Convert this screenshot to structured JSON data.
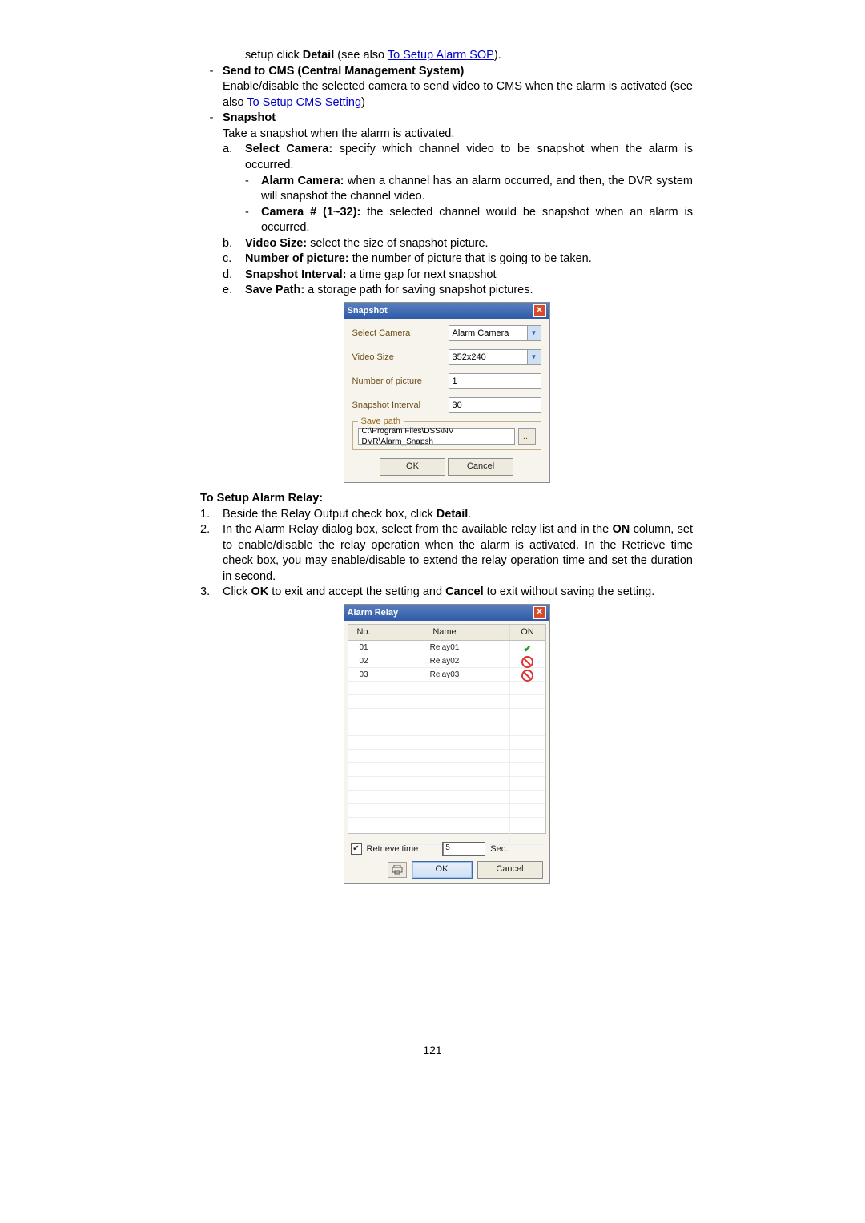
{
  "intro": {
    "line1_a": "setup click ",
    "line1_b": "Detail",
    "line1_c": " (see also ",
    "link_sop": "To Setup Alarm SOP",
    "line1_d": ")."
  },
  "cms": {
    "heading": "Send to CMS (Central Management System)",
    "body_a": "Enable/disable the selected camera to send video to CMS when the alarm is activated (see also ",
    "link": "To Setup CMS Setting",
    "body_b": ")"
  },
  "snapshot": {
    "heading": "Snapshot",
    "body": "Take a snapshot when the alarm is activated.",
    "a_label": "a.",
    "a_bold": "Select Camera:",
    "a_text": " specify which channel video to be snapshot when the alarm is occurred.",
    "dash1_bold": "Alarm Camera:",
    "dash1_text": " when a channel has an alarm occurred, and then, the DVR system will snapshot the channel video.",
    "dash2_bold": "Camera # (1~32):",
    "dash2_text": " the selected channel would be snapshot when an alarm is occurred.",
    "b_label": "b.",
    "b_bold": "Video Size:",
    "b_text": " select the size of snapshot picture.",
    "c_label": "c.",
    "c_bold": "Number of picture:",
    "c_text": " the number of picture that is going to be taken.",
    "d_label": "d.",
    "d_bold": "Snapshot Interval:",
    "d_text": " a time gap for next snapshot",
    "e_label": "e.",
    "e_bold": "Save Path:",
    "e_text": " a storage path for saving snapshot pictures."
  },
  "snapshot_dialog": {
    "title": "Snapshot",
    "labels": {
      "select_camera": "Select Camera",
      "video_size": "Video Size",
      "num_picture": "Number of picture",
      "interval": "Snapshot Interval"
    },
    "values": {
      "select_camera": "Alarm Camera",
      "video_size": "352x240",
      "num_picture": "1",
      "interval": "30"
    },
    "save_legend": "Save path",
    "save_value": "C:\\Program Files\\DSS\\NV DVR\\Alarm_Snapsh",
    "browse": "...",
    "ok": "OK",
    "cancel": "Cancel"
  },
  "relay_section": {
    "heading": "To Setup Alarm Relay:",
    "n1": "1.",
    "t1_a": "Beside the Relay Output check box, click ",
    "t1_b": "Detail",
    "t1_c": ".",
    "n2": "2.",
    "t2_a": "In the Alarm Relay dialog box, select from the available relay list and in the ",
    "t2_b": "ON",
    "t2_c": " column, set to enable/disable the relay operation when the alarm is activated. In the Retrieve time check box, you may enable/disable to extend the relay operation time and set the duration in second.",
    "n3": "3.",
    "t3_a": "Click ",
    "t3_b": "OK",
    "t3_c": " to exit and accept the setting and ",
    "t3_d": "Cancel",
    "t3_e": " to exit without saving the setting."
  },
  "relay_dialog": {
    "title": "Alarm Relay",
    "headers": {
      "no": "No.",
      "name": "Name",
      "on": "ON"
    },
    "rows": [
      {
        "no": "01",
        "name": "Relay01",
        "on": "check"
      },
      {
        "no": "02",
        "name": "Relay02",
        "on": "no"
      },
      {
        "no": "03",
        "name": "Relay03",
        "on": "no"
      }
    ],
    "retrieve_label": "Retrieve time",
    "retrieve_value": "5",
    "sec": "Sec.",
    "ok": "OK",
    "cancel": "Cancel"
  },
  "page_number": "121"
}
